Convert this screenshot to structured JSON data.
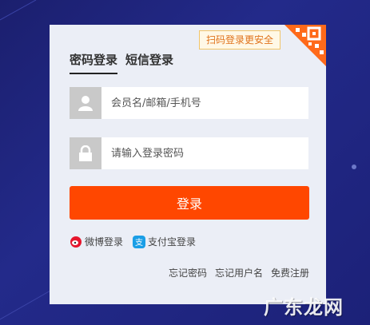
{
  "login": {
    "tabs": [
      {
        "label": "密码登录",
        "active": true
      },
      {
        "label": "短信登录",
        "active": false
      }
    ],
    "qr_tip": "扫码登录更安全",
    "username_placeholder": "会员名/邮箱/手机号",
    "password_placeholder": "请输入登录密码",
    "submit_label": "登录",
    "alt_logins": [
      "微博登录",
      "支付宝登录"
    ],
    "links": [
      "忘记密码",
      "忘记用户名",
      "免费注册"
    ]
  },
  "watermark": "广东龙网",
  "colors": {
    "accent": "#ff4700",
    "background": "#1f2580",
    "card": "#ebeef6"
  }
}
